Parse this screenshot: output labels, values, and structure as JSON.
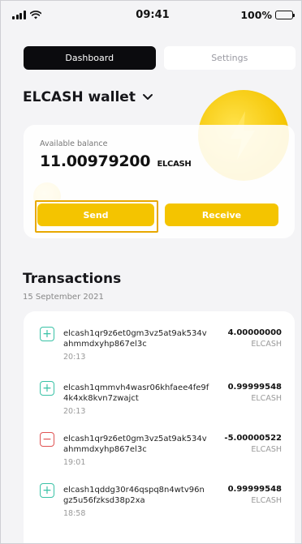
{
  "status_bar": {
    "time": "09:41",
    "battery": "100%"
  },
  "tabs": [
    {
      "label": "Dashboard",
      "active": true
    },
    {
      "label": "Settings",
      "active": false
    }
  ],
  "wallet": {
    "title": "ELCASH wallet"
  },
  "balance": {
    "label": "Available balance",
    "amount": "11.00979200",
    "unit": "ELCASH"
  },
  "actions": {
    "send": "Send",
    "receive": "Receive"
  },
  "transactions": {
    "title": "Transactions",
    "date": "15 September 2021",
    "items": [
      {
        "direction": "in",
        "icon": "+",
        "address": "elcash1qr9z6et0gm3vz5at9ak534vahmmdxyhp867el3c",
        "time": "20:13",
        "amount": "4.00000000",
        "unit": "ELCASH"
      },
      {
        "direction": "in",
        "icon": "+",
        "address": "elcash1qmmvh4wasr06khfaee4fe9f4k4xk8kvn7zwajct",
        "time": "20:13",
        "amount": "0.99999548",
        "unit": "ELCASH"
      },
      {
        "direction": "out",
        "icon": "−",
        "address": "elcash1qr9z6et0gm3vz5at9ak534vahmmdxyhp867el3c",
        "time": "19:01",
        "amount": "-5.00000522",
        "unit": "ELCASH"
      },
      {
        "direction": "in",
        "icon": "+",
        "address": "elcash1qddg30r46qspq8n4wtv96ngz5u56fzksd38p2xa",
        "time": "18:58",
        "amount": "0.99999548",
        "unit": "ELCASH"
      }
    ]
  },
  "colors": {
    "accent": "#f4c400",
    "incoming": "#39c2a6",
    "outgoing": "#e05353",
    "tab_active": "#0b0b0e"
  }
}
